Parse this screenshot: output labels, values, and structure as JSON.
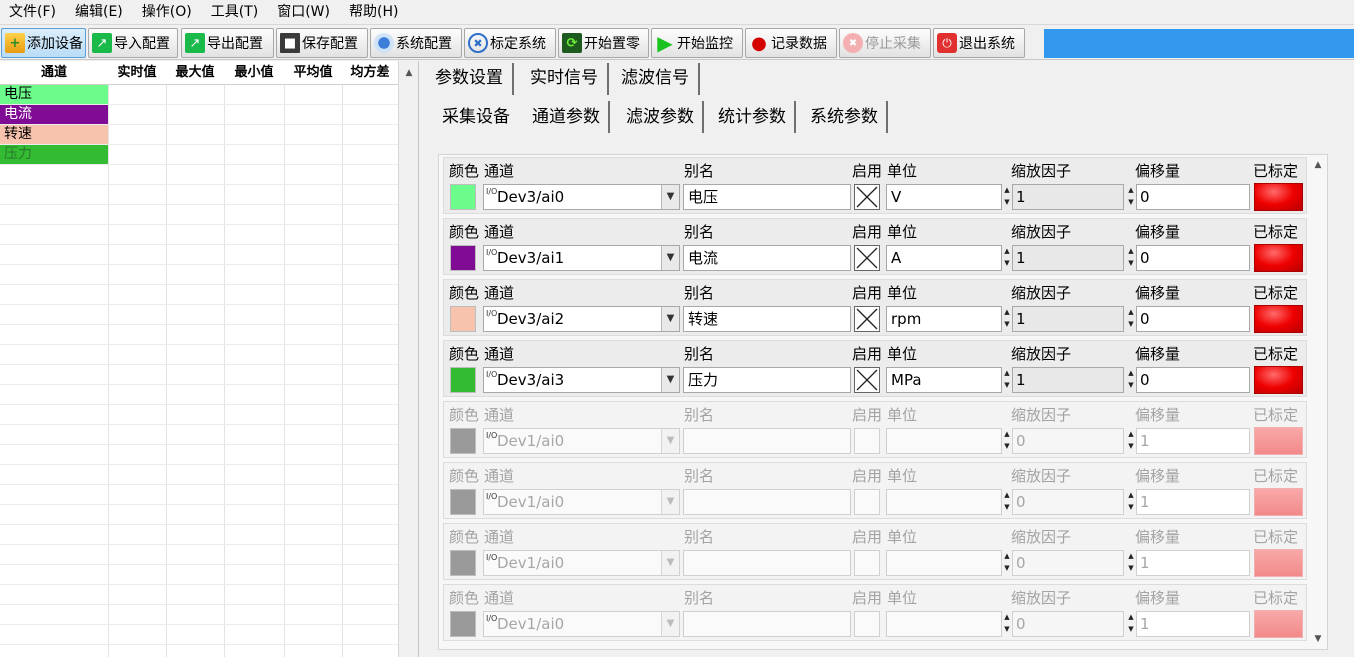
{
  "menu": [
    "文件(F)",
    "编辑(E)",
    "操作(O)",
    "工具(T)",
    "窗口(W)",
    "帮助(H)"
  ],
  "toolbar": {
    "add_device": "添加设备",
    "import_config": "导入配置",
    "export_config": "导出配置",
    "save_config": "保存配置",
    "system_config": "系统配置",
    "calibrate": "标定系统",
    "zero": "开始置零",
    "monitor": "开始监控",
    "record": "记录数据",
    "stop": "停止采集",
    "exit": "退出系统"
  },
  "grid": {
    "headers": [
      "通道",
      "实时值",
      "最大值",
      "最小值",
      "平均值",
      "均方差"
    ],
    "rows": [
      {
        "name": "电压",
        "color": "#6cfc8c",
        "text_color": "#000000"
      },
      {
        "name": "电流",
        "color": "#800b94",
        "text_color": "#ffffff"
      },
      {
        "name": "转速",
        "color": "#f8c3ad",
        "text_color": "#000000"
      },
      {
        "name": "压力",
        "color": "#33bb33",
        "text_color": "#2a7a2a"
      }
    ]
  },
  "tabs_main": [
    "参数设置",
    "实时信号",
    "滤波信号"
  ],
  "tabs_sub": [
    "采集设备",
    "通道参数",
    "滤波参数",
    "统计参数",
    "系统参数"
  ],
  "field_labels": {
    "color": "颜色",
    "channel": "通道",
    "alias": "别名",
    "enable": "启用",
    "unit": "单位",
    "scale": "缩放因子",
    "offset": "偏移量",
    "calibrated": "已标定"
  },
  "channel_prefix": "I/O",
  "channels": [
    {
      "color": "#6cfc8c",
      "channel": "Dev3/ai0",
      "alias": "电压",
      "unit": "V",
      "scale": "1",
      "offset": "0",
      "enabled": true
    },
    {
      "color": "#800b94",
      "channel": "Dev3/ai1",
      "alias": "电流",
      "unit": "A",
      "scale": "1",
      "offset": "0",
      "enabled": true
    },
    {
      "color": "#f8c3ad",
      "channel": "Dev3/ai2",
      "alias": "转速",
      "unit": "rpm",
      "scale": "1",
      "offset": "0",
      "enabled": true
    },
    {
      "color": "#33bb33",
      "channel": "Dev3/ai3",
      "alias": "压力",
      "unit": "MPa",
      "scale": "1",
      "offset": "0",
      "enabled": true
    },
    {
      "color": "#9a9a9a",
      "channel": "Dev1/ai0",
      "alias": "",
      "unit": "",
      "scale": "0",
      "offset": "1",
      "enabled": false
    },
    {
      "color": "#9a9a9a",
      "channel": "Dev1/ai0",
      "alias": "",
      "unit": "",
      "scale": "0",
      "offset": "1",
      "enabled": false
    },
    {
      "color": "#9a9a9a",
      "channel": "Dev1/ai0",
      "alias": "",
      "unit": "",
      "scale": "0",
      "offset": "1",
      "enabled": false
    },
    {
      "color": "#9a9a9a",
      "channel": "Dev1/ai0",
      "alias": "",
      "unit": "",
      "scale": "0",
      "offset": "1",
      "enabled": false
    }
  ]
}
